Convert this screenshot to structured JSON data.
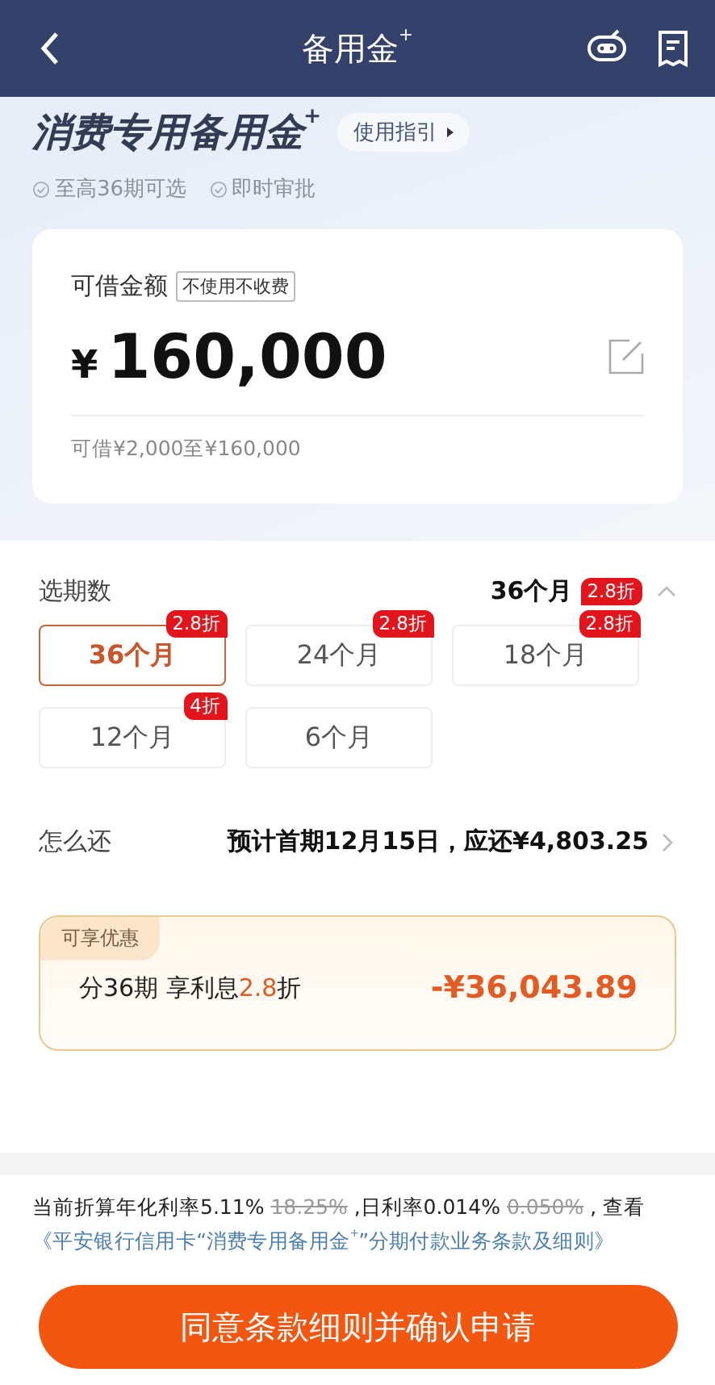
{
  "nav": {
    "title": "备用金$^{+}$"
  },
  "hero": {
    "title": "消费专用备用金$^{+}$",
    "guide_button": "使用指引",
    "features": [
      "至高36期可选",
      "即时审批"
    ]
  },
  "amount_card": {
    "label": "可借金额",
    "tag": "不使用不收费",
    "currency": "¥",
    "amount": "160,000",
    "range": "可借¥2,000至¥160,000"
  },
  "term": {
    "label": "选期数",
    "summary": "36个月",
    "summary_badge": "2.8折",
    "expanded": true,
    "options": [
      {
        "label": "36个月",
        "badge": "2.8折",
        "selected": true
      },
      {
        "label": "24个月",
        "badge": "2.8折",
        "selected": false
      },
      {
        "label": "18个月",
        "badge": "2.8折",
        "selected": false
      },
      {
        "label": "12个月",
        "badge": "4折",
        "selected": false
      },
      {
        "label": "6个月",
        "selected": false
      }
    ]
  },
  "repay": {
    "label": "怎么还",
    "value": "预计首期12月15日，应还¥4,803.25"
  },
  "discount": {
    "tag": "可享优惠",
    "text": [
      {
        "text": "分36期 享利息",
        "highlight": false
      },
      {
        "text": "2.8",
        "highlight": true
      },
      {
        "text": "折",
        "highlight": false
      }
    ],
    "amount": "-¥36,043.89"
  },
  "rate_note": {
    "parts": [
      {
        "text": "当前折算年化利率5.11% ",
        "struck": false
      },
      {
        "text": "18.25%",
        "struck": true
      },
      {
        "text": " ,日利率0.014% ",
        "struck": false
      },
      {
        "text": "0.050%",
        "struck": true
      },
      {
        "text": " , 查看",
        "struck": false
      }
    ],
    "link": "《平安银行信用卡“消费专用备用金$^{+}$”分期付款业务条款及细则》"
  },
  "submit_button": "同意条款细则并确认申请"
}
